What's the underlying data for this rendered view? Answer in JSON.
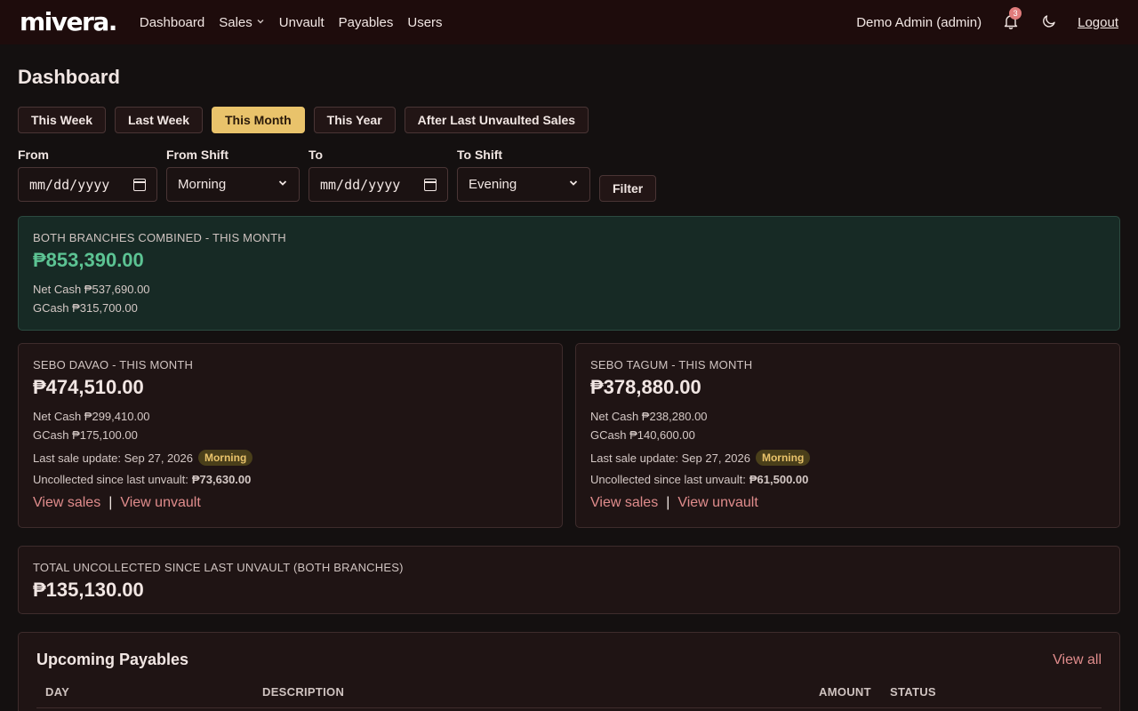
{
  "nav": {
    "brand": "mivera.",
    "links": [
      "Dashboard",
      "Sales",
      "Unvault",
      "Payables",
      "Users"
    ],
    "user": "Demo Admin (admin)",
    "notif_count": "3",
    "logout": "Logout"
  },
  "page": {
    "title": "Dashboard"
  },
  "ranges": [
    "This Week",
    "Last Week",
    "This Month",
    "This Year",
    "After Last Unvaulted Sales"
  ],
  "filters": {
    "from_label": "From",
    "from_value": "mm/dd/yyyy",
    "from_shift_label": "From Shift",
    "from_shift_value": "Morning",
    "to_label": "To",
    "to_value": "mm/dd/yyyy",
    "to_shift_label": "To Shift",
    "to_shift_value": "Evening",
    "filter_button": "Filter"
  },
  "combined": {
    "label": "BOTH BRANCHES COMBINED - THIS MONTH",
    "total": "₱853,390.00",
    "net_cash": "Net Cash ₱537,690.00",
    "gcash": "GCash ₱315,700.00"
  },
  "branches": [
    {
      "label": "SEBO DAVAO - THIS MONTH",
      "total": "₱474,510.00",
      "net_cash": "Net Cash ₱299,410.00",
      "gcash": "GCash ₱175,100.00",
      "last_update": "Last sale update: Sep 27, 2026",
      "shift": "Morning",
      "uncollected_label": "Uncollected since last unvault:",
      "uncollected": "₱73,630.00",
      "view_sales": "View sales",
      "view_unvault": "View unvault"
    },
    {
      "label": "SEBO TAGUM - THIS MONTH",
      "total": "₱378,880.00",
      "net_cash": "Net Cash ₱238,280.00",
      "gcash": "GCash ₱140,600.00",
      "last_update": "Last sale update: Sep 27, 2026",
      "shift": "Morning",
      "uncollected_label": "Uncollected since last unvault:",
      "uncollected": "₱61,500.00",
      "view_sales": "View sales",
      "view_unvault": "View unvault"
    }
  ],
  "total_uncollected": {
    "label": "TOTAL UNCOLLECTED SINCE LAST UNVAULT (BOTH BRANCHES)",
    "value": "₱135,130.00"
  },
  "payables": {
    "title": "Upcoming Payables",
    "view_all": "View all",
    "columns": [
      "DAY",
      "DESCRIPTION",
      "AMOUNT",
      "STATUS"
    ]
  },
  "colors": {
    "accent": "#e9c36b",
    "link": "#e08c8c",
    "green": "#5cc393",
    "navbar": "#1e0c0c"
  },
  "icons": [
    "bell-icon",
    "moon-icon",
    "calendar-icon",
    "chevron-down-icon"
  ]
}
